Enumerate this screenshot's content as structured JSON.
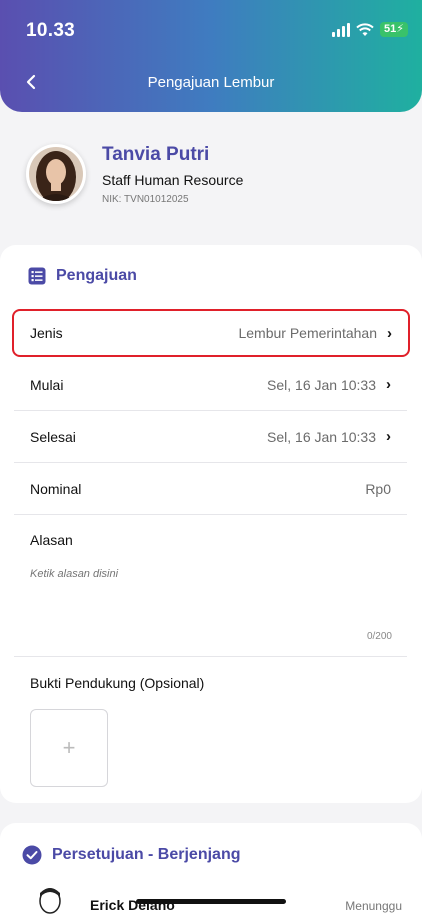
{
  "status_bar": {
    "time": "10.33",
    "battery": "51"
  },
  "header": {
    "title": "Pengajuan Lembur"
  },
  "profile": {
    "name": "Tanvia Putri",
    "role": "Staff Human Resource",
    "nik": "NIK: TVN01012025"
  },
  "pengajuan": {
    "title": "Pengajuan",
    "rows": [
      {
        "label": "Jenis",
        "value": "Lembur Pemerintahan"
      },
      {
        "label": "Mulai",
        "value": "Sel, 16 Jan 10:33"
      },
      {
        "label": "Selesai",
        "value": "Sel, 16 Jan 10:33"
      },
      {
        "label": "Nominal",
        "value": "Rp0"
      }
    ],
    "alasan_label": "Alasan",
    "alasan_placeholder": "Ketik alasan disini",
    "alasan_count": "0/200",
    "bukti_label": "Bukti Pendukung (Opsional)",
    "upload_symbol": "+"
  },
  "persetujuan": {
    "title": "Persetujuan - Berjenjang",
    "approver_name": "Erick Delano",
    "approver_status": "Menunggu"
  },
  "colors": {
    "accent": "#4b4aa6",
    "highlight": "#e0202a",
    "battery": "#39c26a"
  }
}
